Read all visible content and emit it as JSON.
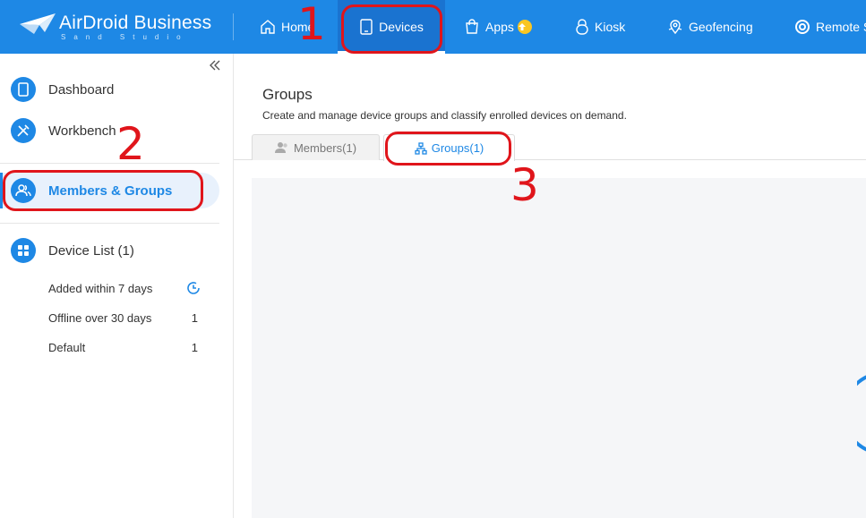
{
  "brand": {
    "name": "AirDroid Business",
    "sub": "Sand Studio"
  },
  "nav": [
    {
      "label": "Home",
      "icon": "home-icon"
    },
    {
      "label": "Devices",
      "icon": "tablet-icon",
      "active": true
    },
    {
      "label": "Apps",
      "icon": "shopping-bag-icon",
      "badge": "upgrade-arrow-icon"
    },
    {
      "label": "Kiosk",
      "icon": "kiosk-lock-icon"
    },
    {
      "label": "Geofencing",
      "icon": "map-pin-icon"
    },
    {
      "label": "Remote S",
      "icon": "lifebuoy-icon"
    }
  ],
  "sidebar": {
    "items": [
      {
        "label": "Dashboard",
        "icon": "tablet-icon"
      },
      {
        "label": "Workbench",
        "icon": "tools-icon"
      },
      {
        "label": "Members & Groups",
        "icon": "users-icon",
        "active": true
      },
      {
        "label": "Device List (1)",
        "icon": "grid-icon"
      }
    ],
    "sub_items": [
      {
        "label": "Added within 7 days",
        "icon": "clock-icon"
      },
      {
        "label": "Offline over 30 days",
        "count": "1"
      },
      {
        "label": "Default",
        "count": "1"
      }
    ]
  },
  "main": {
    "title": "Groups",
    "description": "Create and manage device groups and classify enrolled devices on demand.",
    "tabs": [
      {
        "label": "Members(1)",
        "icon": "members-icon"
      },
      {
        "label": "Groups(1)",
        "icon": "hierarchy-icon",
        "active": true
      }
    ]
  },
  "annotations": [
    "1",
    "2",
    "3"
  ],
  "colors": {
    "primary": "#1e88e5",
    "annotation": "#e0151b",
    "upgrade": "#f9c623"
  }
}
